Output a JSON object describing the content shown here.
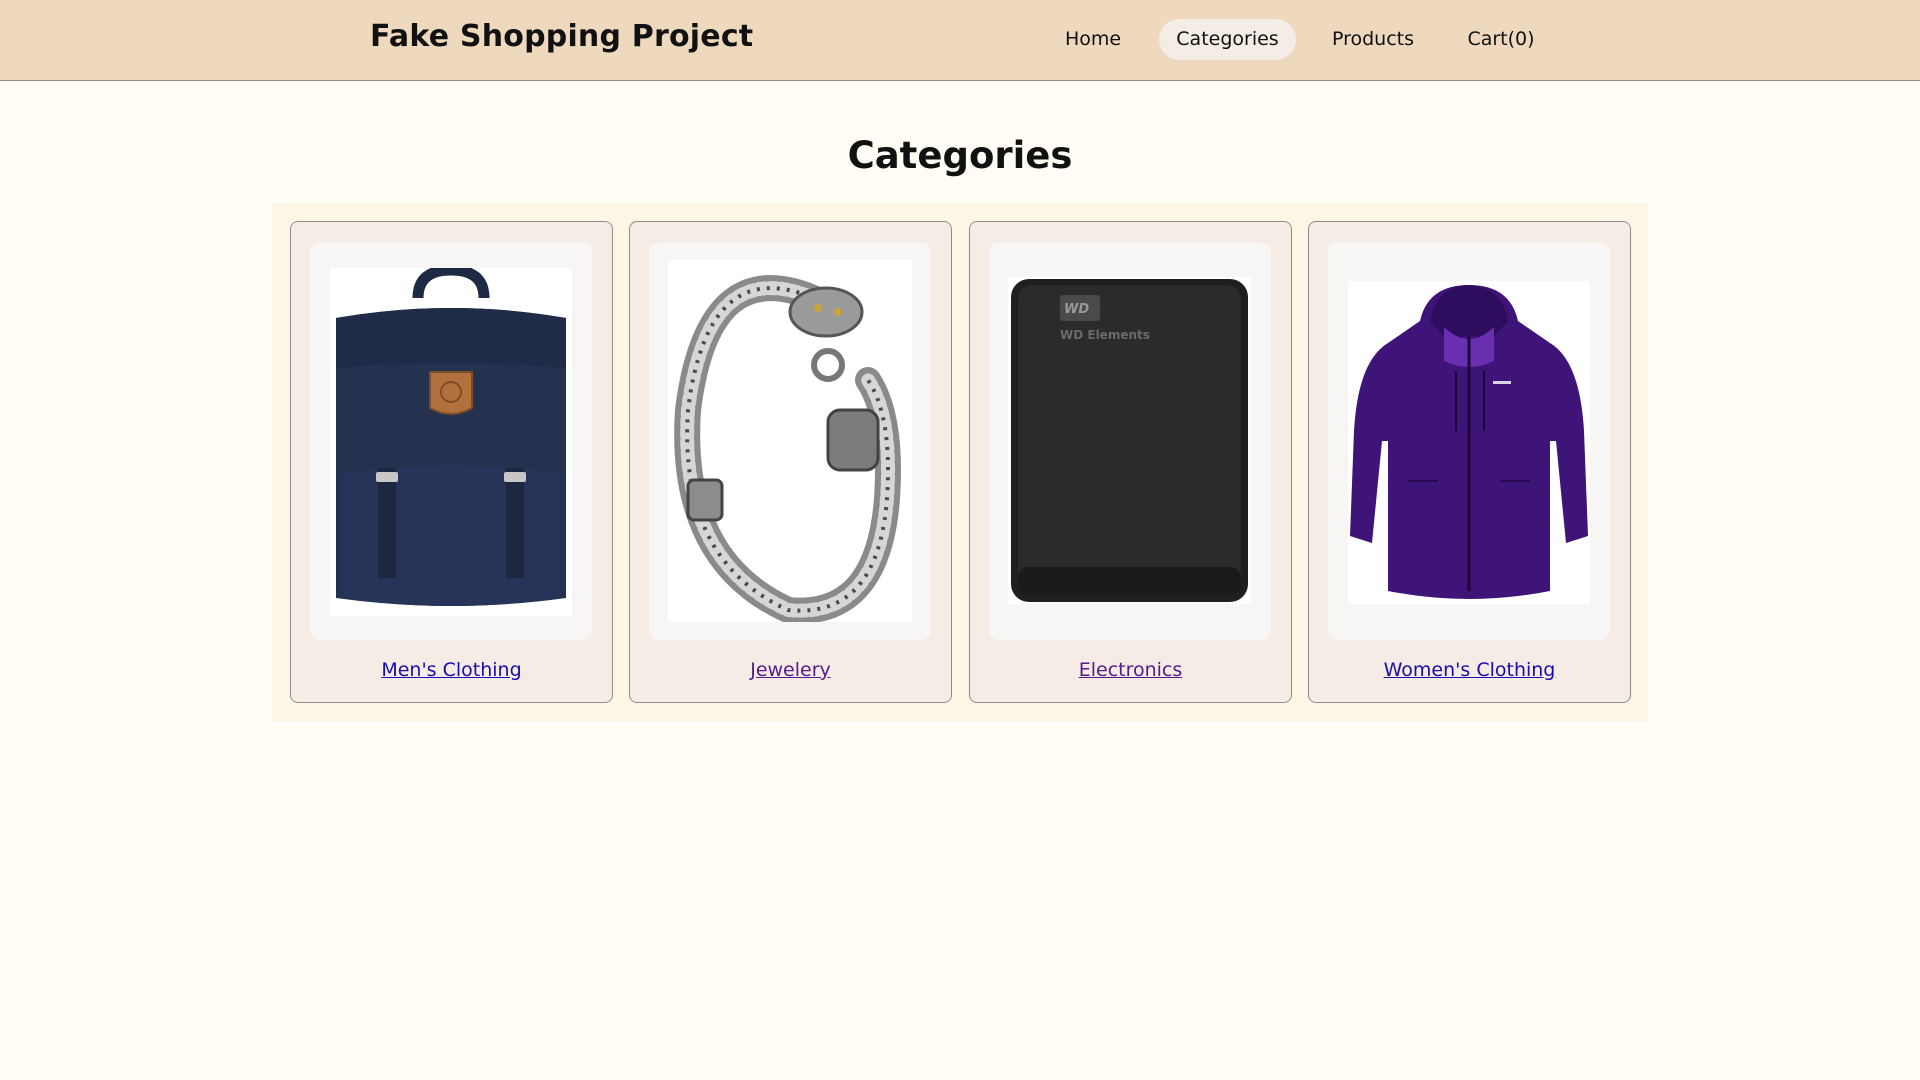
{
  "header": {
    "brand": "Fake Shopping Project",
    "nav": [
      {
        "label": "Home",
        "active": false
      },
      {
        "label": "Categories",
        "active": true
      },
      {
        "label": "Products",
        "active": false
      },
      {
        "label": "Cart(0)",
        "active": false
      }
    ]
  },
  "main": {
    "title": "Categories",
    "categories": [
      {
        "label": "Men's Clothing",
        "image": "backpack-image"
      },
      {
        "label": "Jewelery",
        "image": "bracelet-image"
      },
      {
        "label": "Electronics",
        "image": "hard-drive-image",
        "product_text": "WD Elements"
      },
      {
        "label": "Women's Clothing",
        "image": "jacket-image"
      }
    ]
  },
  "colors": {
    "header_bg": "#eed9bf",
    "page_bg": "#fffdf5",
    "card_bg": "#f5ece6",
    "link": "#1a0dab",
    "link_visited": "#551a8b"
  }
}
